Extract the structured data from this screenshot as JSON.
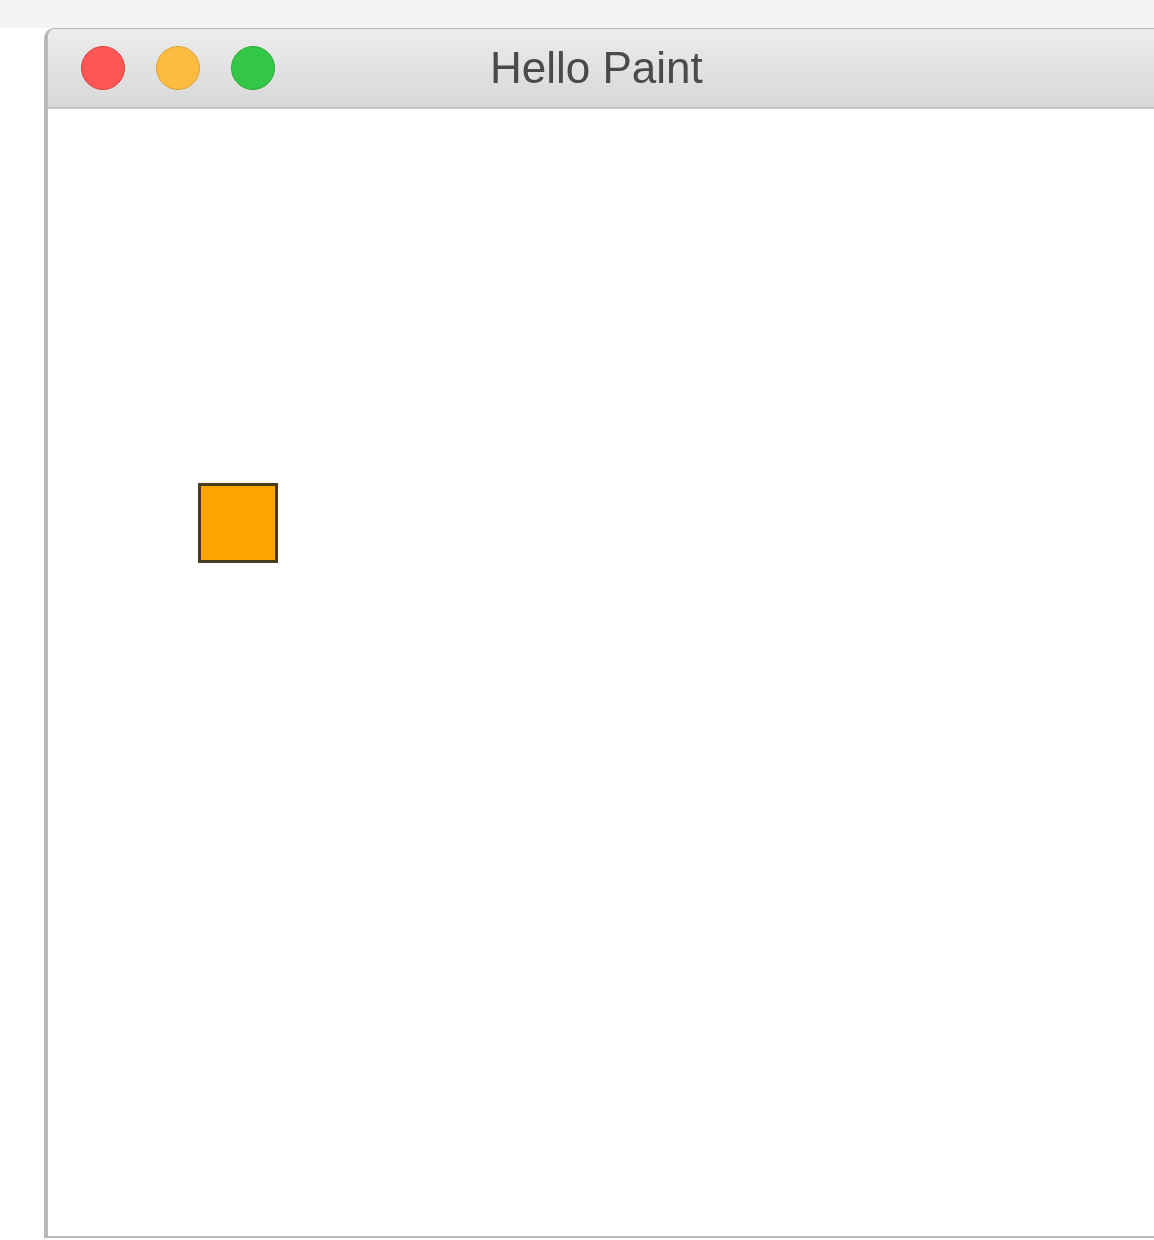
{
  "window": {
    "title": "Hello Paint"
  },
  "canvas": {
    "shapes": [
      {
        "kind": "square"
      }
    ]
  }
}
